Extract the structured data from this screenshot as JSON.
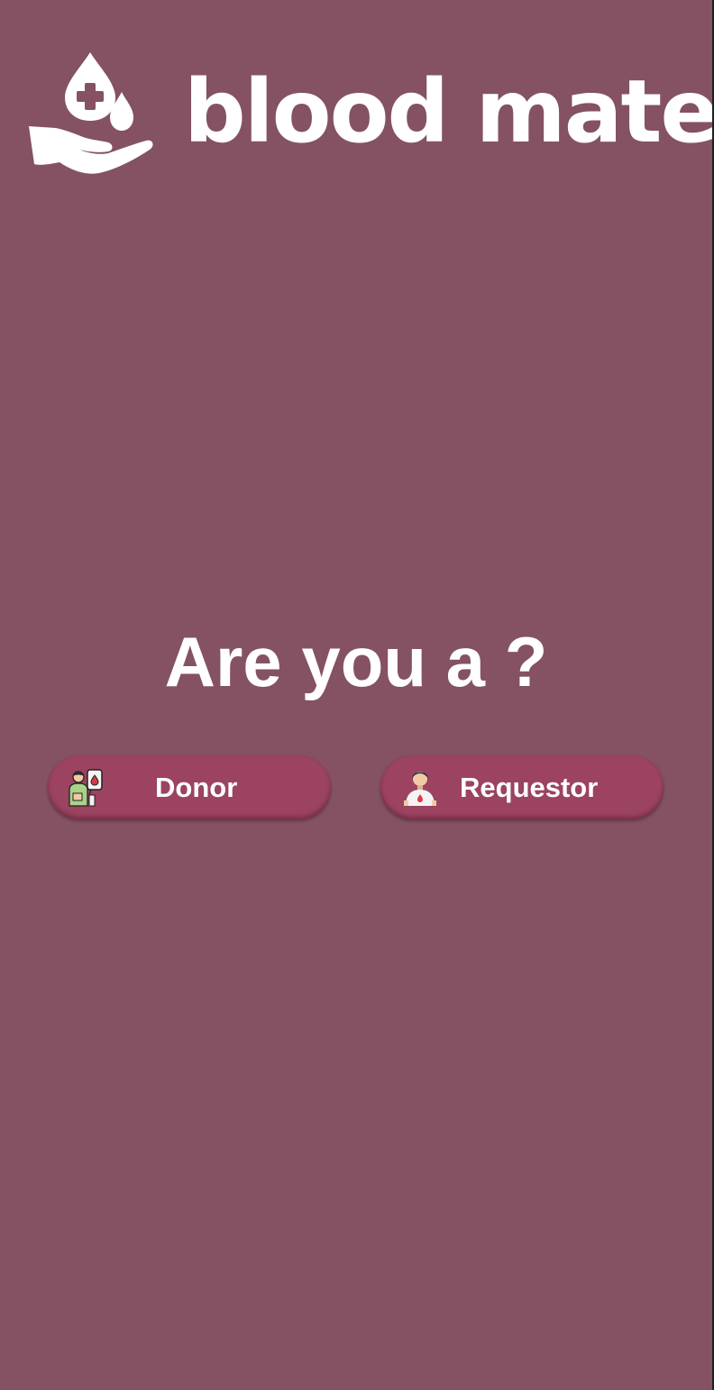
{
  "app": {
    "brand_name": "blood mate",
    "logo_icon": "hand-with-blood-drops-icon"
  },
  "prompt": {
    "question": "Are you a ?"
  },
  "roles": [
    {
      "label": "Donor",
      "icon": "donor-person-icon"
    },
    {
      "label": "Requestor",
      "icon": "requestor-person-icon"
    }
  ],
  "colors": {
    "background": "#845262",
    "button": "#9b4361",
    "text": "#ffffff"
  }
}
